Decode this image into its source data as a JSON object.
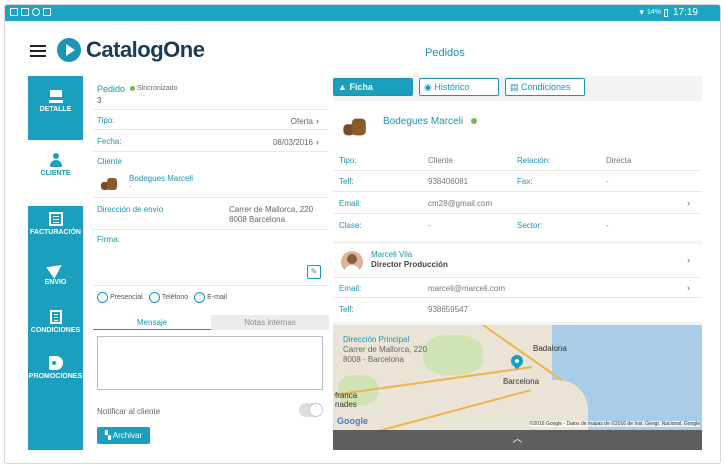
{
  "status_bar": {
    "battery": "14%",
    "time": "17:19"
  },
  "header": {
    "brand": "CatalogOne",
    "title": "Pedidos"
  },
  "sidebar": {
    "items": [
      {
        "label": "DETALLE",
        "icon": "cart-icon"
      },
      {
        "label": "CLIENTE",
        "icon": "user-icon"
      },
      {
        "label": "FACTURACIÓN",
        "icon": "invoice-icon"
      },
      {
        "label": "ENVIO",
        "icon": "send-icon"
      },
      {
        "label": "CONDICIONES",
        "icon": "document-icon"
      },
      {
        "label": "PROMOCIONES",
        "icon": "tag-icon"
      }
    ],
    "active": "CLIENTE"
  },
  "order": {
    "label": "Pedido",
    "sync_status": "Sincronizado",
    "number": "3",
    "tipo_label": "Tipo:",
    "tipo_value": "Oferta",
    "fecha_label": "Fecha:",
    "fecha_value": "08/03/2016",
    "cliente_label": "Cliente",
    "cliente_name": "Bodegues Marceli",
    "cliente_sub": "-",
    "direccion_label": "Dirección de envío",
    "direccion_line1": "Carrer de Mallorca, 220",
    "direccion_line2": "8008 Barcelona",
    "firma_label": "Firma:",
    "radio_options": [
      "Presencial",
      "Teléfono",
      "E-mail"
    ],
    "tabs": [
      "Mensaje",
      "Notas internas"
    ],
    "notify_label": "Notificar al cliente",
    "archive_label": "Archivar"
  },
  "client_detail": {
    "tabs": [
      "Ficha",
      "Histórico",
      "Condiciones"
    ],
    "name": "Bodegues Marceli",
    "fields": {
      "tipo_label": "Tipo:",
      "tipo_value": "Cliente",
      "relacion_label": "Relación:",
      "relacion_value": "Directa",
      "telf_label": "Telf:",
      "telf_value": "938406081",
      "fax_label": "Fax:",
      "fax_value": "-",
      "email_label": "Email:",
      "email_value": "cm28@gmail.com",
      "clase_label": "Clase:",
      "clase_value": "-",
      "sector_label": "Sector:",
      "sector_value": "-"
    },
    "contact": {
      "name": "Marceli Vila",
      "role": "Director Producción",
      "email_label": "Email:",
      "email_value": "marceli@marceli.com",
      "telf_label": "Telf:",
      "telf_value": "938659547"
    },
    "map": {
      "address_title": "Dirección Principal",
      "address_line1": "Carrer de Mallorca, 220",
      "address_line2": "8008 - Barcelona",
      "city_label": "Barcelona",
      "badalona_label": "Badalona",
      "franca_label": "franca",
      "nades_label": "nades",
      "google": "Google",
      "copyright": "©2016 Google - Datos de mapas de ©2016 de Inst. Geogr. Nacional, Google"
    }
  }
}
